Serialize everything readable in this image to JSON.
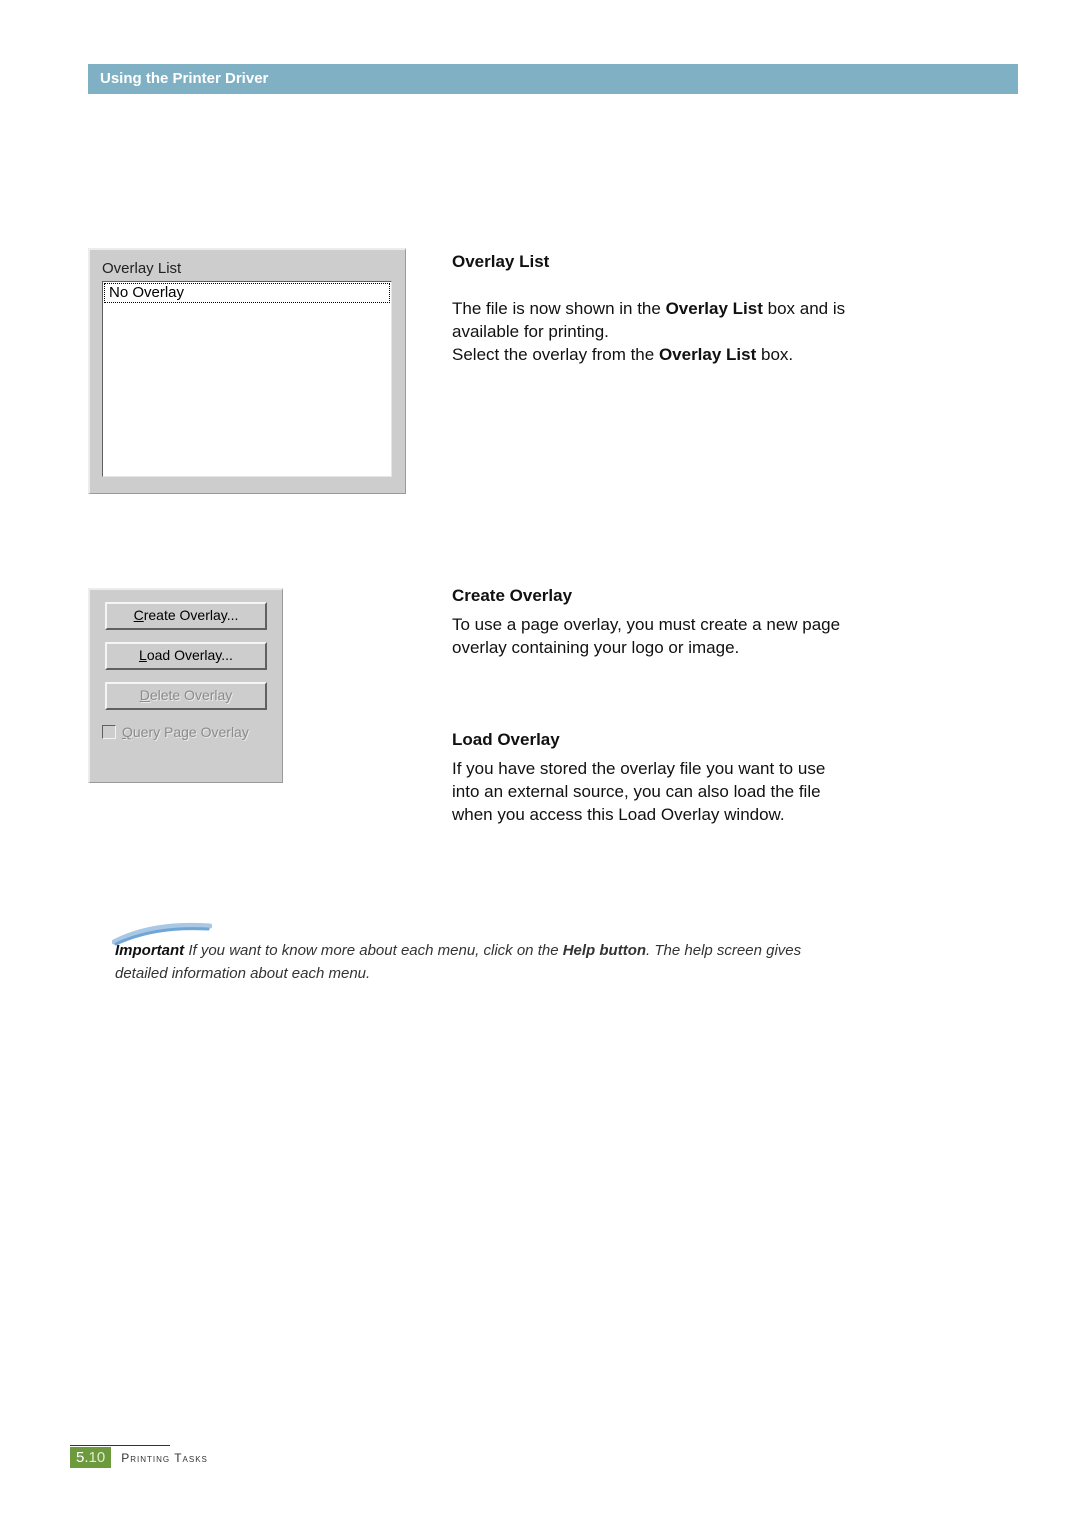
{
  "header": {
    "title": "Using the Printer Driver"
  },
  "panel_overlay_list": {
    "label": "Overlay List",
    "items": [
      "No Overlay"
    ]
  },
  "panel_buttons": {
    "create": "Create Overlay...",
    "load": "Load Overlay...",
    "delete": "Delete Overlay",
    "query": "Query Page Overlay"
  },
  "sections": {
    "overlay_list": {
      "heading": "Overlay List",
      "para_html": "The file is now shown in the <b>Overlay List</b> box and is available for printing.<br>Select the overlay from the <b>Overlay List</b> box."
    },
    "create": {
      "heading": "Create Overlay",
      "para": "To use a page overlay, you must create a new page overlay containing your logo or image."
    },
    "load": {
      "heading": "Load Overlay",
      "para": "If you have stored the overlay file you want to use into an external source, you can also load the file when you access this Load Overlay window."
    }
  },
  "note": {
    "lead": "Important",
    "line1_a": " If you want to know more about each menu, click on the ",
    "help_button": "Help button",
    "line1_b": ". The help screen gives detailed information about each menu."
  },
  "footer": {
    "page_chapter": "5.",
    "page_num": "10",
    "section_label": "Printing Tasks"
  }
}
